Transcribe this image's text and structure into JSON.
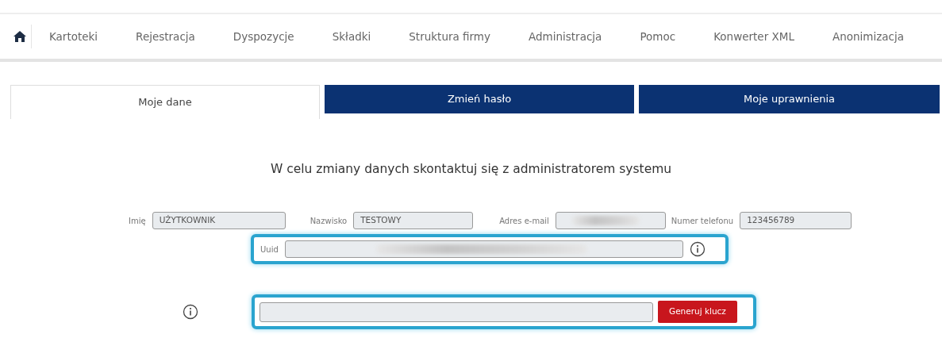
{
  "nav": {
    "items": [
      {
        "label": "Kartoteki"
      },
      {
        "label": "Rejestracja"
      },
      {
        "label": "Dyspozycje"
      },
      {
        "label": "Składki"
      },
      {
        "label": "Struktura firmy"
      },
      {
        "label": "Administracja"
      },
      {
        "label": "Pomoc"
      },
      {
        "label": "Konwerter XML"
      },
      {
        "label": "Anonimizacja"
      }
    ]
  },
  "tabs": [
    {
      "label": "Moje dane",
      "selected": true
    },
    {
      "label": "Zmień hasło",
      "selected": false
    },
    {
      "label": "Moje uprawnienia",
      "selected": false
    }
  ],
  "notice": "W celu zmiany danych skontaktuj się z administratorem systemu",
  "fields": [
    {
      "label": "Imię",
      "value": "UŻYTKOWNIK",
      "redacted": false
    },
    {
      "label": "Nazwisko",
      "value": "TESTOWY",
      "redacted": false
    },
    {
      "label": "Adres e-mail",
      "redacted": true
    },
    {
      "label": "Numer telefonu",
      "value": "123456789",
      "redacted": false
    }
  ],
  "uuid": {
    "label": "Uuid",
    "redacted": true,
    "highlighted": true
  },
  "key": {
    "highlighted": true,
    "button": "Generuj klucz"
  }
}
